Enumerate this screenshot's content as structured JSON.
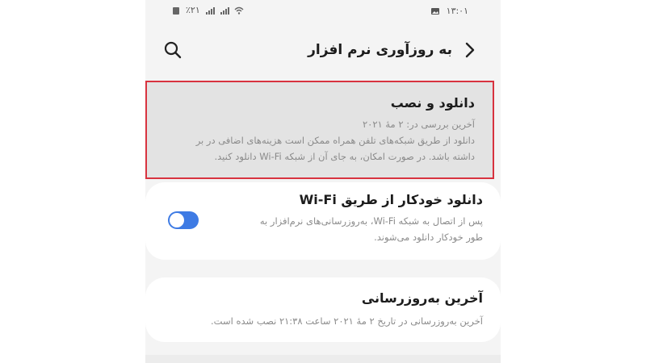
{
  "status_bar": {
    "left_text": "٪۲۱",
    "time": "۱۳:۰۱",
    "icons": [
      "sim-icon",
      "battery-percent",
      "signal-icon",
      "signal-icon",
      "wifi-icon",
      "image-icon"
    ]
  },
  "header": {
    "title": "به روزآوری نرم افزار",
    "search_icon": "search-icon",
    "back_icon": "chevron-right-icon"
  },
  "cards": {
    "download": {
      "title": "دانلود و نصب",
      "last_check": "آخرین بررسی در: ۲ مهٔ ۲۰۲۱",
      "desc_line1": "دانلود از طریق شبکه‌های تلفن همراه ممکن است هزینه‌های اضافی در بر",
      "desc_line2": "داشته باشد. در صورت امکان، به جای آن از شبکه Wi-Fi دانلود کنید.",
      "highlight_color": "#d8333f"
    },
    "wifi_auto": {
      "title": "دانلود خودکار از طریق Wi-Fi",
      "desc_line1": "پس از اتصال به شبکه Wi-Fi، به‌روزرسانی‌های نرم‌افزار به",
      "desc_line2": "طور خودکار دانلود می‌شوند.",
      "toggle_on": true,
      "toggle_color": "#3e7be4"
    },
    "last_update": {
      "title": "آخرین به‌روزرسانی",
      "desc": "آخرین به‌روزرسانی در تاریخ ۲ مهٔ ۲۰۲۱ ساعت ۲۱:۳۸ نصب شده است."
    }
  }
}
